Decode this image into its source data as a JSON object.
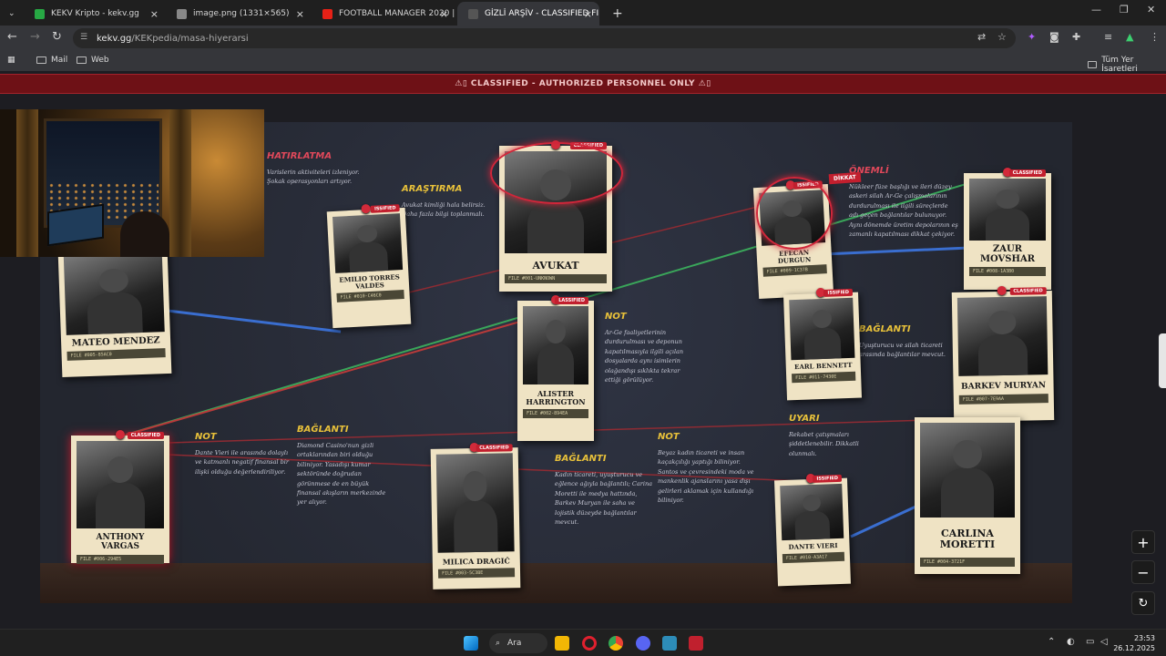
{
  "tabs": [
    {
      "title": "KEKV Kripto - kekv.gg",
      "fav": "#27a844"
    },
    {
      "title": "image.png (1331×565)",
      "fav": "#888888"
    },
    {
      "title": "FOOTBALL MANAGER 2020 | 2(",
      "fav": "#e62117"
    },
    {
      "title": "GİZLİ ARŞİV - CLASSIFIED FILES",
      "fav": "#555555"
    }
  ],
  "new_tab": "+",
  "url": {
    "host": "kekv.gg",
    "path": "/KEKpedia/masa-hiyerarsi"
  },
  "bookmarks": {
    "mail": "Mail",
    "web": "Web",
    "all": "Tüm Yer İşaretleri"
  },
  "banner": "⚠▯ CLASSIFIED - AUTHORIZED PERSONNEL ONLY ⚠▯",
  "cards": [
    {
      "name": "MATEO MENDEZ",
      "file": "FILE #005-85AC0",
      "stamp": ""
    },
    {
      "name": "EMILIO TORRES VALDES",
      "file": "FILE #010-C46C0",
      "stamp": "ISSIFIED"
    },
    {
      "name": "AVUKAT",
      "file": "FILE #001-UNKNOWN",
      "stamp": "CLASSIFIED"
    },
    {
      "name": "ALISTER HARRINGTON",
      "file": "FILE #002-894EA",
      "stamp": "LASSIFIED"
    },
    {
      "name": "EFECAN DURGUN",
      "file": "FILE #009-1C37B",
      "stamp": "ISSIFIED"
    },
    {
      "name": "ZAUR MOVSHAR",
      "file": "FILE #008-1A3B0",
      "stamp": "CLASSIFIED"
    },
    {
      "name": "EARL BENNETT",
      "file": "FILE #011-7430E",
      "stamp": "ISSIFIED"
    },
    {
      "name": "BARKEV MURYAN",
      "file": "FILE #007-7E9AA",
      "stamp": "CLASSIFIED"
    },
    {
      "name": "ANTHONY VARGAS",
      "file": "FILE #006-294E5",
      "stamp": "CLASSIFIED"
    },
    {
      "name": "MILICA DRAGIĆ",
      "file": "FILE #003-5C3BE",
      "stamp": "CLASSIFIED"
    },
    {
      "name": "DANTE VIERI",
      "file": "FILE #010-A3A17",
      "stamp": "ISSIFIED"
    },
    {
      "name": "CARLINA MORETTI",
      "file": "FILE #004-3721F",
      "stamp": ""
    }
  ],
  "dikkat": "DİKKAT",
  "notes": [
    {
      "h": "HATIRLATMA",
      "t": "Varislerin aktiviteleri izleniyor. Şokak operasyonları artıyor.",
      "color": "#e0485a"
    },
    {
      "h": "ARAŞTIRMA",
      "t": "Avukat kimliği hala belirsiz. Daha fazla bilgi toplanmalı.",
      "color": "#e8c13a"
    },
    {
      "h": "ÖNEMLİ",
      "t": "Nükleer füze başlığı ve ileri düzey askeri silah Ar-Ge çalışmalarının durdurulması ile ilgili süreçlerde adı geçen bağlantılar bulunuyor. Aynı dönemde üretim depolarının eş zamanlı kapatılması dikkat çekiyor.",
      "color": "#e0485a"
    },
    {
      "h": "NOT",
      "t": "Ar-Ge faaliyetlerinin durdurulması ve deponun kapatılmasıyla ilgili açılan dosyalarda aynı isimlerin olağandışı sıklıkta tekrar ettiği görülüyor.",
      "color": "#e8c13a"
    },
    {
      "h": "BAĞLANTI",
      "t": "Uyuşturucu ve silah ticareti arasında bağlantılar mevcut.",
      "color": "#e8c13a"
    },
    {
      "h": "NOT",
      "t": "Dante Vieri ile arasında dolaylı ve katmanlı negatif finansal bir ilişki olduğu değerlendiriliyor.",
      "color": "#e8c13a"
    },
    {
      "h": "BAĞLANTI",
      "t": "Diamond Casino'nun gizli ortaklarından biri olduğu biliniyor. Yasadışı kumar sektöründe doğrudan görünmese de en büyük finansal akışların merkezinde yer alıyor.",
      "color": "#e8c13a"
    },
    {
      "h": "BAĞLANTI",
      "t": "Kadın ticareti, uyuşturucu ve eğlence ağıyla bağlantılı; Carina Moretti ile medya hattında, Barkev Muryan ile saha ve lojistik düzeyde bağlantılar mevcut.",
      "color": "#e8c13a"
    },
    {
      "h": "NOT",
      "t": "Beyaz kadın ticareti ve insan kaçakçılığı yaptığı biliniyor. Santos ve çevresindeki moda ve mankenlik ajanslarını yasa dışı gelirleri aklamak için kullandığı biliniyor.",
      "color": "#e8c13a"
    },
    {
      "h": "UYARI",
      "t": "Rekabet çatışmaları şiddetlenebilir. Dikkatli olunmalı.",
      "color": "#e8c13a"
    }
  ],
  "side_buttons": [
    "+",
    "−",
    "↻"
  ],
  "taskbar": {
    "search": "Ara",
    "time": "23:53",
    "date": "26.12.2025"
  }
}
